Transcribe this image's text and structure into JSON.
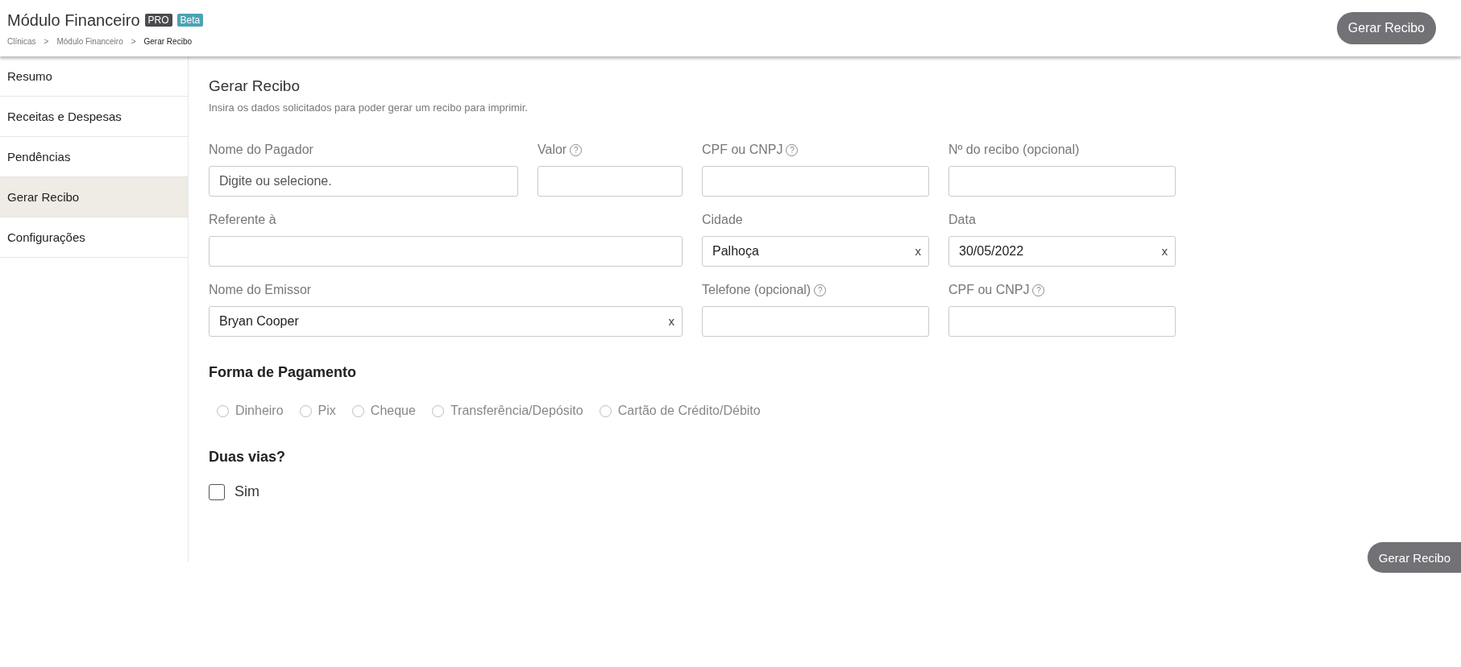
{
  "header": {
    "title": "Módulo Financeiro",
    "badges": [
      {
        "label": "PRO",
        "color": "#4a4a4f"
      },
      {
        "label": "Beta",
        "color": "#4aa3b5"
      }
    ],
    "breadcrumb": [
      {
        "label": "Clínicas",
        "current": false
      },
      {
        "sep": ">"
      },
      {
        "label": "Módulo Financeiro",
        "current": false
      },
      {
        "sep": ">"
      },
      {
        "label": "Gerar Recibo",
        "current": true
      }
    ],
    "button": "Gerar Recibo"
  },
  "sidebar": {
    "items": [
      {
        "label": "Resumo",
        "selected": false
      },
      {
        "label": "Receitas e Despesas",
        "selected": false
      },
      {
        "label": "Pendências",
        "selected": false
      },
      {
        "label": "Gerar Recibo",
        "selected": true
      },
      {
        "label": "Configurações",
        "selected": false
      }
    ]
  },
  "form": {
    "title": "Gerar Recibo",
    "subtitle": "Insira os dados solicitados para poder gerar um recibo para imprimir.",
    "rows": [
      [
        {
          "label": "Nome do Pagador",
          "placeholder": "Digite ou selecione."
        },
        {
          "label": "Valor",
          "help": "?"
        },
        {
          "label": "CPF ou CNPJ",
          "help": "?"
        },
        {
          "label": "Nº do recibo (opcional)"
        }
      ],
      [
        {
          "label": "Referente à"
        },
        "",
        {
          "label": "Cidade",
          "value": "Palhoça",
          "clear": "x"
        },
        {
          "label": "Data",
          "value": "30/05/2022",
          "clear": "x"
        }
      ],
      [
        {
          "label": "Nome do Emissor",
          "value": "Bryan Cooper",
          "clear": "x"
        },
        "",
        {
          "label": "Telefone (opcional)",
          "help": "?"
        },
        {
          "label": "CPF ou CNPJ",
          "help": "?"
        }
      ]
    ],
    "payment": {
      "title": "Forma de Pagamento",
      "options": [
        {
          "label": "Dinheiro",
          "selected": false
        },
        {
          "label": "Pix",
          "selected": false
        },
        {
          "label": "Cheque",
          "selected": false
        },
        {
          "label": "Transferência/Depósito",
          "selected": false
        },
        {
          "label": "Cartão de Crédito/Débito",
          "selected": false
        }
      ]
    },
    "copies": {
      "title": "Duas vias?",
      "label": "Sim",
      "checked": false
    },
    "submit": "Gerar Recibo"
  }
}
